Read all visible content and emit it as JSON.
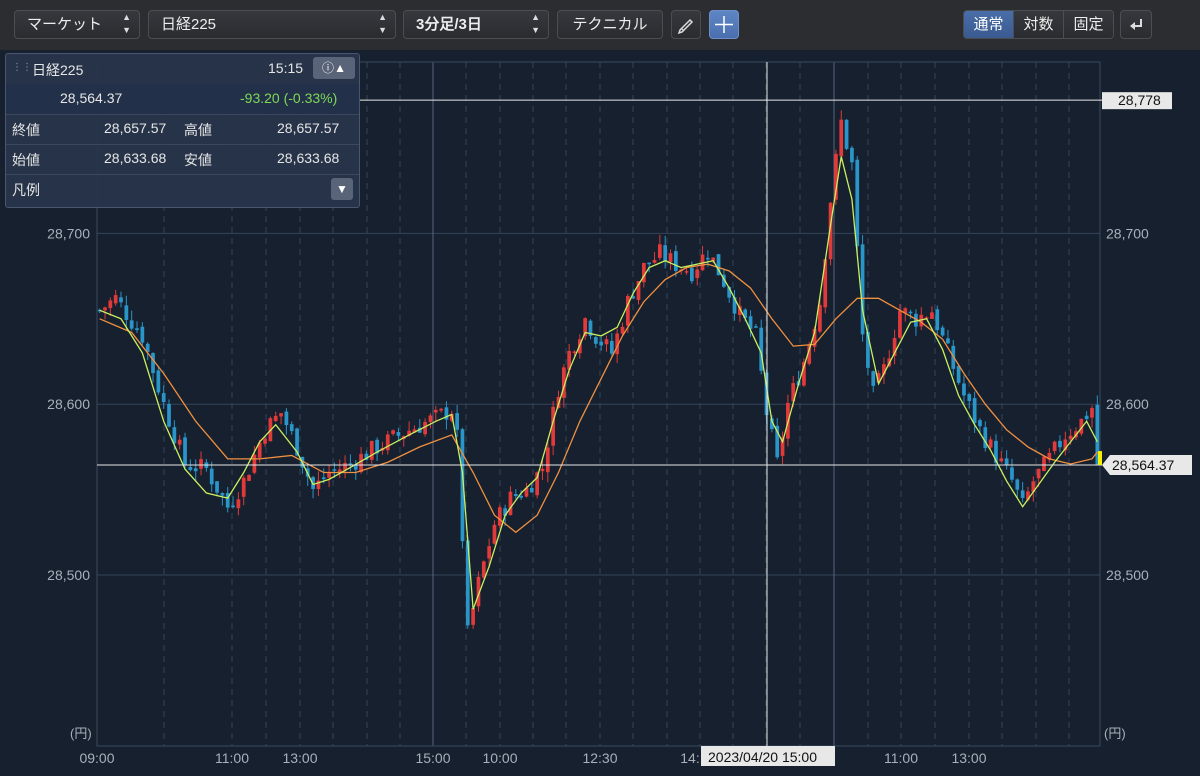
{
  "toolbar": {
    "market_select": "マーケット",
    "symbol_select": "日経225",
    "interval_select": "3分足/3日",
    "technical_button": "テクニカル",
    "pencil_icon": "pencil-icon",
    "crosshair_icon": "crosshair-icon",
    "scale_modes": [
      "通常",
      "対数",
      "固定"
    ],
    "active_scale_mode": "通常",
    "undo_icon": "undo-icon"
  },
  "info_panel": {
    "symbol": "日経225",
    "time": "15:15",
    "price": "28,564.37",
    "change": "-93.20 (-0.33%)",
    "close_label": "終値",
    "close_value": "28,657.57",
    "high_label": "高値",
    "high_value": "28,657.57",
    "open_label": "始値",
    "open_value": "28,633.68",
    "low_label": "安値",
    "low_value": "28,633.68",
    "legend_label": "凡例"
  },
  "colors": {
    "up": "#e03a3a",
    "down": "#2a95c8",
    "ma_short": "#c8f060",
    "ma_long": "#f09040",
    "change_text": "#7ed957",
    "current_marker": "#f5f000"
  },
  "chart_data": {
    "type": "candlestick",
    "unit_label": "(円)",
    "ylim": [
      28430,
      28820
    ],
    "yticks": [
      "28,500",
      "28,600",
      "28,700"
    ],
    "x_labels": [
      "09:00",
      "11:00",
      "13:00",
      "15:00",
      "10:00",
      "12:30",
      "14:",
      "11:00",
      "13:00"
    ],
    "crosshair": {
      "x_label": "2023/04/20 15:00",
      "y_label": "28,778",
      "y_value": 28778
    },
    "current_price": {
      "label": "28,564.37",
      "value": 28564.37
    },
    "close_trend": [
      [
        0,
        28655
      ],
      [
        3,
        28662
      ],
      [
        8,
        28640
      ],
      [
        12,
        28600
      ],
      [
        16,
        28565
      ],
      [
        20,
        28562
      ],
      [
        24,
        28540
      ],
      [
        27,
        28555
      ],
      [
        31,
        28585
      ],
      [
        34,
        28595
      ],
      [
        37,
        28575
      ],
      [
        40,
        28550
      ],
      [
        43,
        28560
      ],
      [
        47,
        28565
      ],
      [
        52,
        28575
      ],
      [
        58,
        28585
      ],
      [
        63,
        28592
      ],
      [
        66,
        28597
      ],
      [
        67,
        28580
      ],
      [
        69,
        28465
      ],
      [
        71,
        28495
      ],
      [
        74,
        28530
      ],
      [
        77,
        28545
      ],
      [
        80,
        28550
      ],
      [
        83,
        28563
      ],
      [
        86,
        28610
      ],
      [
        88,
        28630
      ],
      [
        91,
        28650
      ],
      [
        93,
        28640
      ],
      [
        96,
        28630
      ],
      [
        99,
        28660
      ],
      [
        102,
        28680
      ],
      [
        105,
        28688
      ],
      [
        108,
        28682
      ],
      [
        111,
        28678
      ],
      [
        114,
        28690
      ],
      [
        117,
        28672
      ],
      [
        120,
        28652
      ],
      [
        123,
        28640
      ],
      [
        125,
        28595
      ],
      [
        127,
        28565
      ],
      [
        129,
        28600
      ],
      [
        132,
        28625
      ],
      [
        135,
        28660
      ],
      [
        137,
        28720
      ],
      [
        139,
        28765
      ],
      [
        141,
        28740
      ],
      [
        143,
        28640
      ],
      [
        145,
        28605
      ],
      [
        147,
        28620
      ],
      [
        150,
        28655
      ],
      [
        153,
        28650
      ],
      [
        156,
        28655
      ],
      [
        159,
        28630
      ],
      [
        162,
        28605
      ],
      [
        165,
        28585
      ],
      [
        168,
        28570
      ],
      [
        171,
        28555
      ],
      [
        173,
        28540
      ],
      [
        175,
        28555
      ],
      [
        178,
        28568
      ],
      [
        181,
        28582
      ],
      [
        184,
        28590
      ],
      [
        186,
        28598
      ],
      [
        187,
        28565
      ]
    ],
    "ma_short": [
      [
        0,
        28655
      ],
      [
        4,
        28650
      ],
      [
        8,
        28630
      ],
      [
        12,
        28590
      ],
      [
        16,
        28562
      ],
      [
        20,
        28548
      ],
      [
        24,
        28545
      ],
      [
        27,
        28560
      ],
      [
        30,
        28578
      ],
      [
        33,
        28588
      ],
      [
        37,
        28572
      ],
      [
        40,
        28553
      ],
      [
        43,
        28556
      ],
      [
        47,
        28563
      ],
      [
        52,
        28572
      ],
      [
        58,
        28582
      ],
      [
        63,
        28590
      ],
      [
        66,
        28594
      ],
      [
        68,
        28560
      ],
      [
        70,
        28480
      ],
      [
        73,
        28505
      ],
      [
        76,
        28535
      ],
      [
        79,
        28548
      ],
      [
        82,
        28557
      ],
      [
        85,
        28590
      ],
      [
        88,
        28620
      ],
      [
        91,
        28642
      ],
      [
        94,
        28640
      ],
      [
        97,
        28645
      ],
      [
        100,
        28665
      ],
      [
        103,
        28680
      ],
      [
        106,
        28684
      ],
      [
        109,
        28680
      ],
      [
        112,
        28682
      ],
      [
        115,
        28684
      ],
      [
        118,
        28668
      ],
      [
        121,
        28650
      ],
      [
        124,
        28630
      ],
      [
        126,
        28590
      ],
      [
        128,
        28578
      ],
      [
        131,
        28612
      ],
      [
        134,
        28642
      ],
      [
        137,
        28705
      ],
      [
        139,
        28745
      ],
      [
        141,
        28720
      ],
      [
        143,
        28655
      ],
      [
        146,
        28612
      ],
      [
        149,
        28630
      ],
      [
        152,
        28648
      ],
      [
        155,
        28650
      ],
      [
        158,
        28632
      ],
      [
        161,
        28605
      ],
      [
        164,
        28588
      ],
      [
        167,
        28573
      ],
      [
        170,
        28555
      ],
      [
        173,
        28540
      ],
      [
        176,
        28553
      ],
      [
        179,
        28566
      ],
      [
        182,
        28578
      ],
      [
        185,
        28590
      ],
      [
        187,
        28578
      ]
    ],
    "ma_long": [
      [
        0,
        28650
      ],
      [
        6,
        28642
      ],
      [
        12,
        28618
      ],
      [
        18,
        28590
      ],
      [
        24,
        28568
      ],
      [
        30,
        28568
      ],
      [
        36,
        28570
      ],
      [
        42,
        28560
      ],
      [
        48,
        28560
      ],
      [
        54,
        28566
      ],
      [
        60,
        28575
      ],
      [
        66,
        28582
      ],
      [
        70,
        28560
      ],
      [
        74,
        28535
      ],
      [
        78,
        28525
      ],
      [
        82,
        28535
      ],
      [
        86,
        28560
      ],
      [
        90,
        28590
      ],
      [
        94,
        28615
      ],
      [
        98,
        28640
      ],
      [
        102,
        28660
      ],
      [
        106,
        28673
      ],
      [
        110,
        28680
      ],
      [
        114,
        28682
      ],
      [
        118,
        28678
      ],
      [
        122,
        28668
      ],
      [
        126,
        28650
      ],
      [
        130,
        28634
      ],
      [
        134,
        28635
      ],
      [
        138,
        28650
      ],
      [
        142,
        28662
      ],
      [
        146,
        28662
      ],
      [
        150,
        28655
      ],
      [
        154,
        28648
      ],
      [
        158,
        28638
      ],
      [
        162,
        28618
      ],
      [
        166,
        28600
      ],
      [
        170,
        28585
      ],
      [
        174,
        28575
      ],
      [
        178,
        28568
      ],
      [
        182,
        28565
      ],
      [
        186,
        28568
      ],
      [
        187,
        28572
      ]
    ]
  }
}
